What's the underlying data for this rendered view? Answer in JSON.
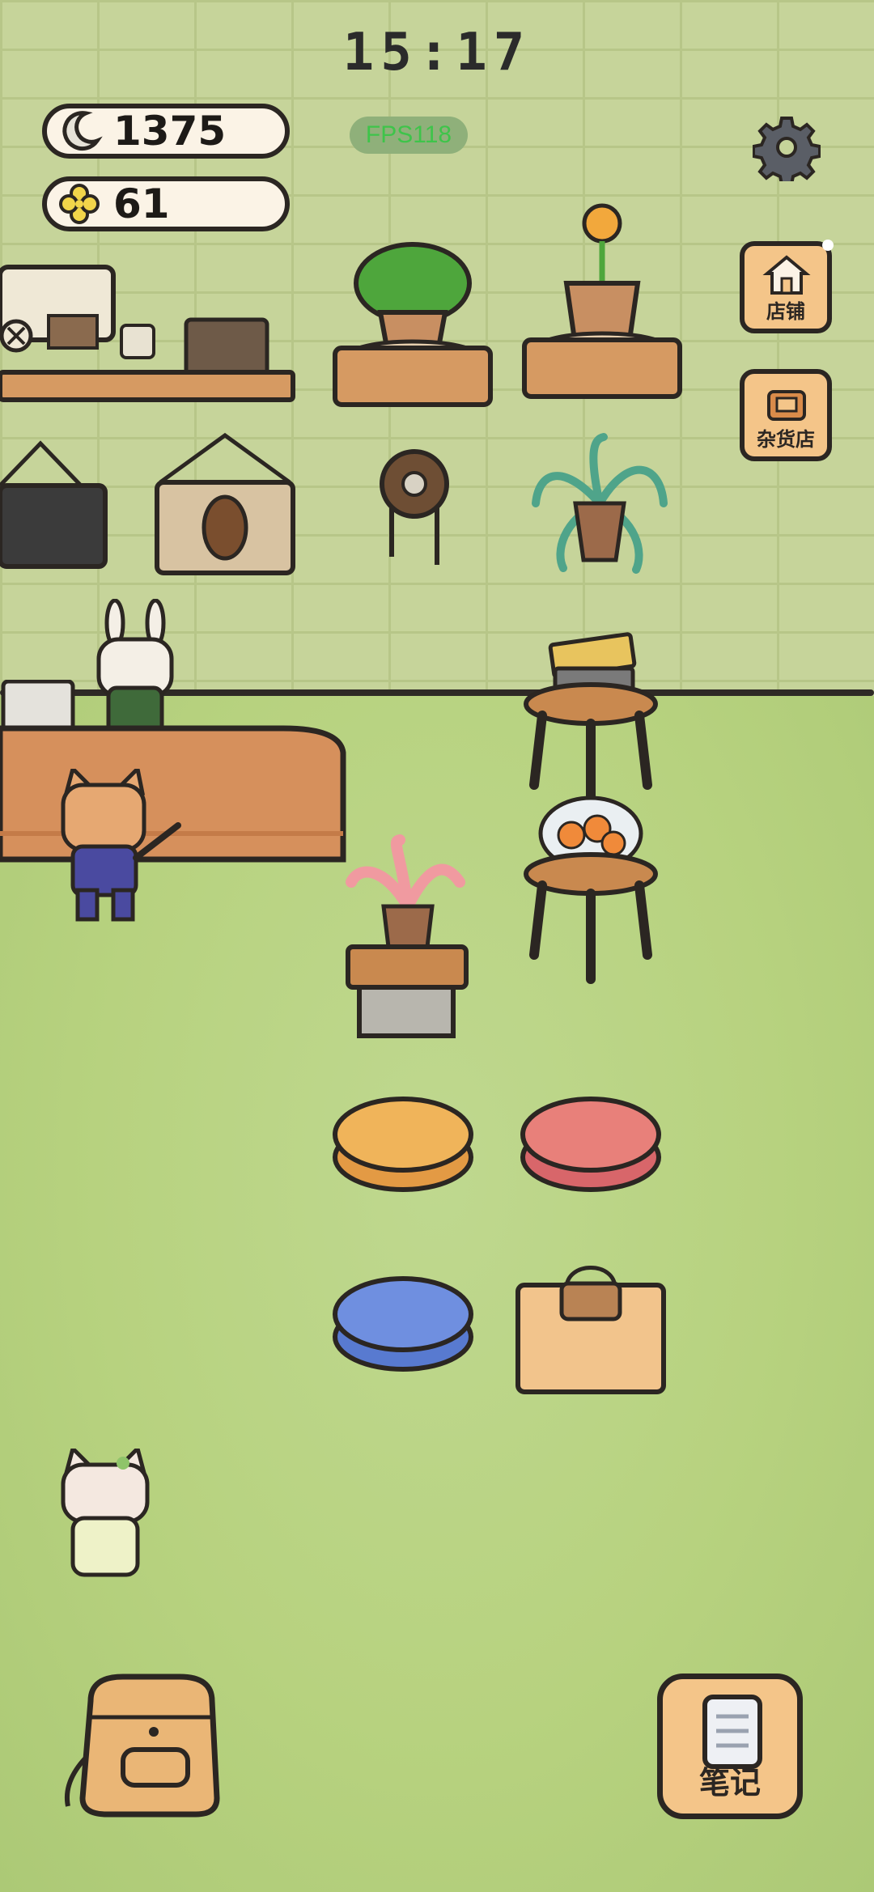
{
  "clock": {
    "time": "15:17"
  },
  "currencies": {
    "moon": {
      "icon": "moon-icon",
      "value": "1375"
    },
    "clover": {
      "icon": "clover-icon",
      "value": "61"
    }
  },
  "fps": {
    "label": "FPS118"
  },
  "settings": {
    "icon": "gear-icon"
  },
  "side_buttons": [
    {
      "label": "店铺",
      "icon": "shop-house-icon"
    },
    {
      "label": "杂货店",
      "icon": "grocery-store-icon"
    }
  ],
  "bottom": {
    "bag_icon": "backpack-icon",
    "notes_label": "笔记",
    "notes_icon": "notebook-icon"
  },
  "colors": {
    "wall": "#c6d49a",
    "lawn": "#b7d27f",
    "button_fill": "#f4c589",
    "outline": "#2b2622",
    "cushion_orange": "#f0b45a",
    "cushion_red": "#e8807a",
    "cushion_blue": "#6f8fe0"
  }
}
